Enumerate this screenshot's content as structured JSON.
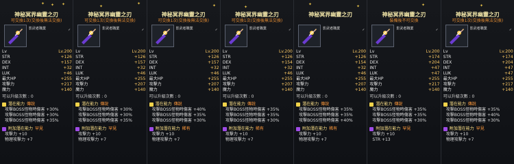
{
  "panels": [
    {
      "title": "神秘冥界幽靈之刃",
      "subtitle": "可交換1次(交換後無法交換)",
      "req_label": "影武者職業",
      "level": "Lv.200",
      "stats": [
        [
          "STR",
          "+126"
        ],
        [
          "DEX",
          "+157"
        ],
        [
          "INT",
          "+32"
        ],
        [
          "LUK",
          "+46"
        ],
        [
          "最大HP",
          "+255"
        ],
        [
          "攻擊力",
          "+217"
        ],
        [
          "魔力",
          "+140"
        ]
      ],
      "upgrade": "可以升級次數 : 0",
      "potential_rank": "傳說",
      "potential_lines": [
        "攻擊BOSS怪物時傷害 +30%",
        "攻擊BOSS怪物時傷害 +30%",
        "攻擊BOSS怪物時傷害 +35%"
      ],
      "additional_rank": "罕見",
      "additional_lines": [
        "攻擊力 +10",
        "物理攻擊力 +7"
      ]
    },
    {
      "title": "神秘冥界幽靈之刃",
      "subtitle": "可交換1次(交換後無法交換)",
      "req_label": "影武者職業",
      "level": "Lv.200",
      "stats": [
        [
          "STR",
          "+126"
        ],
        [
          "DEX",
          "+157"
        ],
        [
          "INT",
          "+32"
        ],
        [
          "LUK",
          "+46"
        ],
        [
          "最大HP",
          "+255"
        ],
        [
          "攻擊力",
          "+207"
        ],
        [
          "魔力",
          "+140"
        ]
      ],
      "upgrade": "可以升級次數 : 0",
      "potential_rank": "傳說",
      "potential_lines": [
        "攻擊BOSS怪物時傷害 +30%",
        "攻擊BOSS怪物時傷害 +30%",
        "攻擊BOSS怪物時傷害 +35%"
      ],
      "additional_rank": "罕見",
      "additional_lines": [
        "攻擊力 +10",
        "物理攻擊力 +7"
      ]
    },
    {
      "title": "神秘冥界幽靈之刃",
      "subtitle": "可交換1次(交換後無法交換)",
      "req_label": "影武者職業",
      "level": "Lv.200",
      "stats": [
        [
          "STR",
          "+126"
        ],
        [
          "DEX",
          "+157"
        ],
        [
          "INT",
          "+32"
        ],
        [
          "LUK",
          "+46"
        ],
        [
          "最大HP",
          "+255"
        ],
        [
          "攻擊力",
          "+207"
        ],
        [
          "魔力",
          "+140"
        ]
      ],
      "upgrade": "可以升級次數 : 0",
      "potential_rank": "傳說",
      "potential_lines": [
        "攻擊BOSS怪物時傷害 +40%",
        "攻擊BOSS怪物時傷害 +35%",
        "攻擊BOSS怪物時傷害 +30%"
      ],
      "additional_rank": "稀有",
      "additional_lines": [
        "攻擊力 +10",
        "物理攻擊力 +7"
      ]
    },
    {
      "title": "神秘冥界幽靈之刃",
      "subtitle": "可交換1次(交換後無法交換)",
      "req_label": "影武者職業",
      "level": "Lv.200",
      "stats": [
        [
          "STR",
          "+126"
        ],
        [
          "DEX",
          "+154"
        ],
        [
          "INT",
          "+32"
        ],
        [
          "LUK",
          "+46"
        ],
        [
          "最大HP",
          "+255"
        ],
        [
          "攻擊力",
          "+207"
        ],
        [
          "魔力",
          "+140"
        ]
      ],
      "upgrade": "可以升級次數 : 0",
      "potential_rank": "傳說",
      "potential_lines": [
        "攻擊BOSS怪物時傷害 +35%",
        "攻擊BOSS怪物時傷害 +35%",
        "攻擊BOSS怪物時傷害 +30%"
      ],
      "additional_rank": "稀有",
      "additional_lines": [
        "攻擊力 +10",
        "物理攻擊力 +7"
      ]
    },
    {
      "title": "神秘冥界幽靈之刃",
      "subtitle": "",
      "req_label": "影武者職業",
      "level": "Lv.200",
      "stats": [
        [
          "STR",
          "+126"
        ],
        [
          "DEX",
          "+154"
        ],
        [
          "INT",
          "+32"
        ],
        [
          "LUK",
          "+46"
        ],
        [
          "最大HP",
          "+255"
        ],
        [
          "攻擊力",
          "+207"
        ],
        [
          "魔力",
          "+140"
        ]
      ],
      "upgrade": "可以升級次數 : 0",
      "potential_rank": "傳說",
      "potential_lines": [
        "攻擊BOSS怪物時傷害 +35%",
        "攻擊BOSS怪物時傷害 +35%",
        "攻擊BOSS怪物時傷害 +40%"
      ],
      "additional_rank": "稀有",
      "additional_lines": [
        "攻擊力 +10",
        "物理攻擊力 +7"
      ]
    },
    {
      "title": "神秘冥界幽靈之刃",
      "subtitle": "裝備後不可交換",
      "req_label": "影武者職業",
      "level": "Lv.200",
      "stats": [
        [
          "STR",
          "+174"
        ],
        [
          "DEX",
          "+204"
        ],
        [
          "INT",
          "+47"
        ],
        [
          "LUK",
          "+47"
        ],
        [
          "最大HP",
          "+255"
        ],
        [
          "攻擊力",
          "+217"
        ],
        [
          "魔力",
          "+140"
        ]
      ],
      "upgrade": "可以升級次數 : 0",
      "potential_rank": "傳說",
      "potential_lines": [
        "攻擊BOSS怪物時傷害 +35%",
        "攻擊BOSS怪物時傷害 +35%",
        "攻擊BOSS怪物時傷害 +30%"
      ],
      "additional_rank": "罕見",
      "additional_lines": [
        "攻擊力 +10",
        "STR +13"
      ]
    },
    {
      "title": "神秘冥界幽靈之刃",
      "subtitle": "可交換1次(交換後無法交換)",
      "req_label": "影武者職業",
      "level": "Lv.200",
      "stats": [
        [
          "STR",
          "+174"
        ],
        [
          "DEX",
          "+204"
        ],
        [
          "INT",
          "+47"
        ],
        [
          "LUK",
          "+47"
        ],
        [
          "最大HP",
          "+255"
        ],
        [
          "攻擊力",
          "+217"
        ],
        [
          "魔力",
          "+140"
        ]
      ],
      "upgrade": "可以升級次數 : 0",
      "potential_rank": "傳說",
      "potential_lines": [
        "攻擊BOSS怪物時傷害 +35%",
        "攻擊BOSS怪物時傷害 +40%",
        "攻擊BOSS怪物時傷害 +30%"
      ],
      "additional_rank": "罕見",
      "additional_lines": [
        "攻擊力 +10",
        "物理攻擊力 +7"
      ]
    }
  ],
  "colors": {
    "title": "#f2e6a8",
    "subtitle": "#e08a32",
    "stat_value": "#ffcc66",
    "potential_label": "#ffe38a",
    "potential_rank": "#ff9a3c"
  },
  "labels": {
    "potential_header": "潛在能力",
    "additional_header": "附加潛在能力"
  }
}
